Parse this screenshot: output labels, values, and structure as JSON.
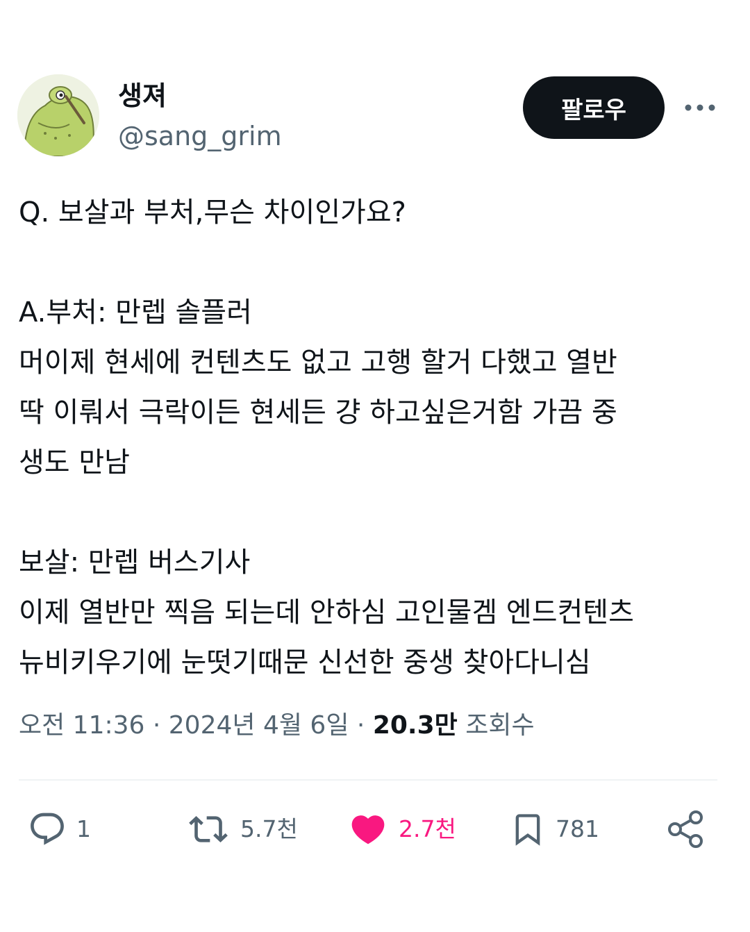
{
  "author": {
    "display_name": "생져",
    "handle": "@sang_grim"
  },
  "follow_button_label": "팔로우",
  "more_icon": "more-horizontal-icon",
  "tweet": {
    "paragraphs": [
      [
        "Q. 보살과 부처,무슨 차이인가요?"
      ],
      [
        "A.부처: 만렙 솔플러",
        "머이제 현세에 컨텐츠도 없고 고행 할거 다했고 열반",
        "딱 이뤄서 극락이든 현세든 걍 하고싶은거함 가끔 중",
        "생도 만남"
      ],
      [
        "보살: 만렙 버스기사",
        "이제 열반만 찍음 되는데 안하심 고인물겜 엔드컨텐츠",
        "뉴비키우기에 눈떳기때문 신선한 중생 찾아다니심"
      ]
    ]
  },
  "meta": {
    "time": "오전 11:36",
    "separator": " · ",
    "date": "2024년 4월 6일",
    "views_count": "20.3만",
    "views_label": "조회수"
  },
  "actions": {
    "reply": {
      "icon": "reply-icon",
      "count": "1"
    },
    "retweet": {
      "icon": "retweet-icon",
      "count": "5.7천"
    },
    "like": {
      "icon": "heart-icon",
      "count": "2.7천",
      "liked": true
    },
    "bookmark": {
      "icon": "bookmark-icon",
      "count": "781"
    },
    "share": {
      "icon": "share-icon"
    }
  },
  "colors": {
    "text": "#0f1419",
    "secondary": "#536471",
    "like": "#f91880",
    "button_bg": "#0f1419"
  }
}
